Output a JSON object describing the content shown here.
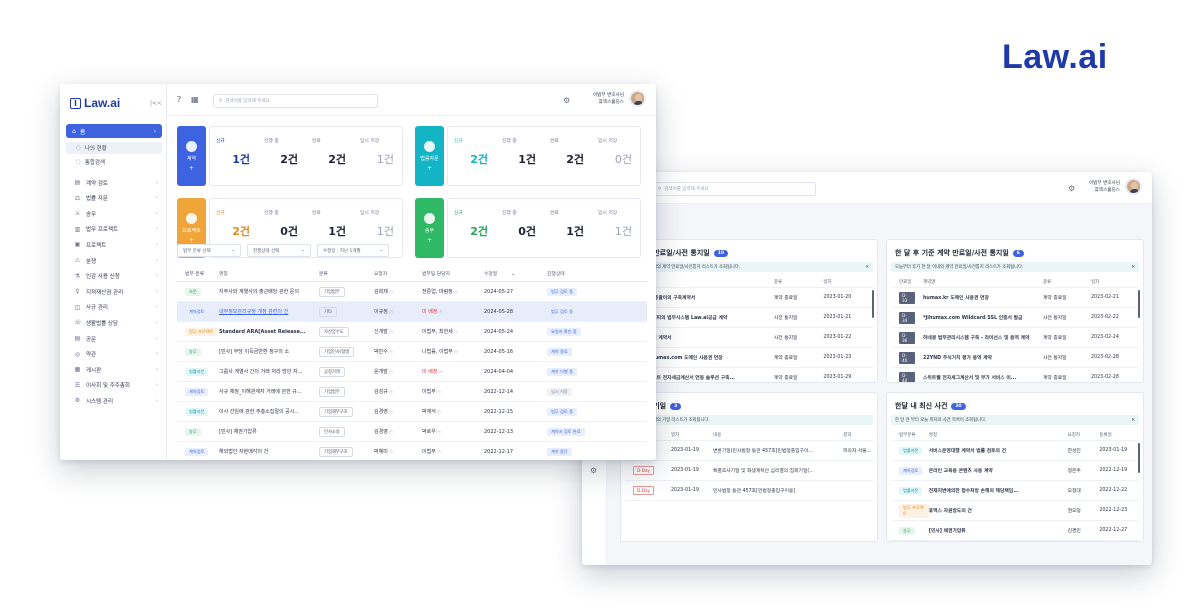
{
  "brand": "Law.ai",
  "window_a": {
    "logo": "Law.ai",
    "collapse": "|<<",
    "search_placeholder": "검색어를 입력해 주세요",
    "user_name": "이법무 변호사님",
    "user_org": "휴맥스홀딩스",
    "home_label": "홈",
    "home_sub": [
      "나의 현황",
      "통합검색"
    ],
    "nav": [
      "계약 검토",
      "법률 자문",
      "송무",
      "법무 프로젝트",
      "프로젝트",
      "분쟁",
      "인감 사용 신청",
      "지적재산권 관리",
      "사규 관리",
      "생활법률 상담",
      "공문",
      "약관",
      "게시판",
      "이사회 및 주주총회",
      "시스템 관리"
    ],
    "cards": [
      {
        "tile": "계약",
        "color": "#3d63e0",
        "stats": [
          {
            "label": "신규",
            "value": "1건",
            "cls": "hi"
          },
          {
            "label": "진행 중",
            "value": "2건",
            "cls": ""
          },
          {
            "label": "완료",
            "value": "2건",
            "cls": ""
          },
          {
            "label": "임시 저장",
            "value": "1건",
            "cls": "muted"
          }
        ]
      },
      {
        "tile": "법률자문",
        "color": "#13b5c4",
        "stats": [
          {
            "label": "신규",
            "value": "2건",
            "cls": "tl"
          },
          {
            "label": "진행 중",
            "value": "1건",
            "cls": ""
          },
          {
            "label": "완료",
            "value": "2건",
            "cls": ""
          },
          {
            "label": "임시 저장",
            "value": "0건",
            "cls": "muted"
          }
        ]
      },
      {
        "tile": "프로젝트",
        "color": "#f0a53a",
        "stats": [
          {
            "label": "신규",
            "value": "2건",
            "cls": "or"
          },
          {
            "label": "진행 중",
            "value": "0건",
            "cls": ""
          },
          {
            "label": "완료",
            "value": "1건",
            "cls": ""
          },
          {
            "label": "임시 저장",
            "value": "1건",
            "cls": "muted"
          }
        ]
      },
      {
        "tile": "송무",
        "color": "#2fb866",
        "stats": [
          {
            "label": "신규",
            "value": "2건",
            "cls": "gr"
          },
          {
            "label": "진행 중",
            "value": "0건",
            "cls": ""
          },
          {
            "label": "완료",
            "value": "1건",
            "cls": ""
          },
          {
            "label": "임시 저장",
            "value": "1건",
            "cls": "muted"
          }
        ]
      }
    ],
    "filters": [
      "법무 분류 선택",
      "진행상태 선택",
      "수정일 : 지난 1개월"
    ],
    "headers": [
      "법무 분류",
      "명칭",
      "분류",
      "요청자",
      "법무팀 담당자",
      "수정일",
      "진행상태"
    ],
    "rows": [
      {
        "cat": "자문",
        "catcls": "g",
        "title": "지주사와 계열사의 출근배당 관한 문의",
        "type": "기업법무",
        "req": "김희재",
        "owner": "전준업, 마림정",
        "date": "2024-05-27",
        "status": "법무 검토 중",
        "sel": false,
        "tstyle": ""
      },
      {
        "cat": "계약검토",
        "catcls": "b",
        "title": "내부정보관리규정 개정 관련의 건",
        "type": "기타",
        "req": "이규정",
        "owner": "미 배정",
        "date": "2024-05-28",
        "status": "법무 검토 중",
        "sel": true,
        "tstyle": "link",
        "ostyle": "red"
      },
      {
        "cat": "법무 프로젝트",
        "catcls": "o",
        "title": "Standard ARA[Asset Release...",
        "type": "자산양수도",
        "req": "신개발",
        "owner": "이법무, 최한세",
        "date": "2024-05-24",
        "status": "요청자 확인 중",
        "sel": false,
        "tstyle": "bold"
      },
      {
        "cat": "송무",
        "catcls": "g",
        "title": "[민사] 부당 이득금반환 청구의 소",
        "type": "기업민사/합병",
        "req": "박민수",
        "owner": "나법률, 이법무",
        "date": "2024-05-16",
        "status": "계약 종료",
        "sel": false,
        "tstyle": ""
      },
      {
        "cat": "법률자문",
        "catcls": "t",
        "title": "그룹사 계열사 간의 거래 처리 방안 자...",
        "type": "공정거래",
        "req": "윤개발",
        "owner": "미 배정",
        "date": "2024-04-04",
        "status": "계약 이행 중",
        "sel": false,
        "tstyle": "",
        "ostyle": "red"
      },
      {
        "cat": "계약검토",
        "catcls": "b",
        "title": "사규 제정_이해관계자 거래에 관한 규...",
        "type": "기업법무",
        "req": "김성규",
        "owner": "이법무",
        "date": "2022-12-14",
        "status": "임시 저장",
        "sel": false,
        "tstyle": ""
      },
      {
        "cat": "법률자문",
        "catcls": "t",
        "title": "이사 선임에 관한 주총소집절의 공시...",
        "type": "기업재무구조",
        "req": "김경영",
        "owner": "박재석",
        "date": "2022-12-15",
        "status": "법무 검토 중",
        "sel": false,
        "tstyle": ""
      },
      {
        "cat": "송무",
        "catcls": "g",
        "title": "[민사] 채권가압류",
        "type": "민사소송",
        "req": "김경영",
        "owner": "박로우",
        "date": "2022-12-13",
        "status": "계약서 검토 완료",
        "sel": false,
        "tstyle": ""
      },
      {
        "cat": "계약검토",
        "catcls": "b",
        "title": "해외법인 자본매각의 건",
        "type": "기업재무구조",
        "req": "박혜미",
        "owner": "이법무",
        "date": "2022-12-17",
        "status": "계약 중단",
        "sel": false,
        "tstyle": ""
      }
    ]
  },
  "window_b": {
    "search_placeholder": "검색어를 입력해 주세요",
    "user_name": "이법무 변호사님",
    "user_org": "휴맥스홀딩스",
    "heading": "함",
    "panel1": {
      "title": "준 계약 만료일/사전 통지일",
      "count": "10",
      "note": "후가 한 달 이내의 계약 만료일/사전통지 리스트가 조회됩니다.",
      "headers": [
        "계약명",
        "종류",
        "일자"
      ],
      "rows": [
        [
          "로이터 총괄이의 구축계약서",
          "계약 종료일",
          "2023-01-20"
        ],
        [
          "휴맥스이피의 법무시스템 Law.ai공급 계약",
          "사전 통지일",
          "2023-01-21"
        ],
        [
          "클린해빗 계약서",
          "사전 통지일",
          "2023-01-22"
        ],
        [
          "dearhumax.com 도메인 사용권 연장",
          "계약 종료일",
          "2023-01-23"
        ],
        [
          "딜타래스트 전자세금계산서 연동 솔루션 구축...",
          "계약 종료일",
          "2023-01-29"
        ]
      ]
    },
    "panel2": {
      "title": "한 달 후 기준 계약 만료일/사전 통지일",
      "count": "6",
      "note": "오늘부터 후가 한 달 이내의 계약 만료일/사전통지 리스트가 조회됩니다.",
      "headers": [
        "만료일",
        "계약명",
        "종류",
        "일자"
      ],
      "rows": [
        [
          "D-33",
          "humax.kr 도메인 사용권 연장",
          "계약 종료일",
          "2023-02-21"
        ],
        [
          "D-34",
          "*Jihumax.com Wildcard SSL 인증서 발급",
          "사전 통지일",
          "2023-02-22"
        ],
        [
          "D-36",
          "하네콩 법무관리시스템 구축 - 라이선스 및 용역 계약",
          "계약 종료일",
          "2023-02-24"
        ],
        [
          "D-40",
          "22YND 주식거치 평가 용역 계약",
          "사전 통지일",
          "2023-02-28"
        ],
        [
          "D-40",
          "스위트웰 전자세그계산서 및 부가 서비스 이...",
          "계약 종료일",
          "2023-02-28"
        ]
      ]
    },
    "panel3": {
      "title": "한 송무 기일",
      "count": "3",
      "note": "후가 한 달 이내의 기일 리스트가 조회됩니다.",
      "headers": [
        "일자",
        "내용",
        "결과"
      ],
      "rows": [
        [
          "D-Day",
          "2023-01-19",
          "변론기일(민사법정 동관 457호[민법정출입구이...",
          "피의자 서울..."
        ],
        [
          "D-Day",
          "2023-01-19",
          "특별조사기일 및 화생계획안 심리결의 집회기일(...",
          ""
        ],
        [
          "D-Day",
          "2023-01-19",
          "민사법정 동관 457호[민법정출입구이용]",
          ""
        ]
      ]
    },
    "panel4": {
      "title": "한달 내 최신 사건",
      "count": "30",
      "note": "한 달 전 부터 오늘 까지의 사건 목록이 조회됩니다.",
      "headers": [
        "법무분류",
        "명칭",
        "요청자",
        "등록일"
      ],
      "rows": [
        [
          "법률자문",
          "서비스운영대행 계약서 법률 검토의 건",
          "한성진",
          "2023-01-19",
          "t"
        ],
        [
          "계약검토",
          "온라인 교육용 콘텐츠 사용 계약",
          "정은주",
          "2022-12-19",
          "b"
        ],
        [
          "법률자문",
          "전재지변에의한 접수처방 손해의 해당책임...",
          "오정대",
          "2022-12-22",
          "t"
        ],
        [
          "법무 프로젝트",
          "휴맥스 자원방도의 건",
          "권오정",
          "2022-12-23",
          "o"
        ],
        [
          "송무",
          "[민사] 채권가압류",
          "김경민",
          "2022-12-27",
          "g"
        ]
      ]
    }
  }
}
